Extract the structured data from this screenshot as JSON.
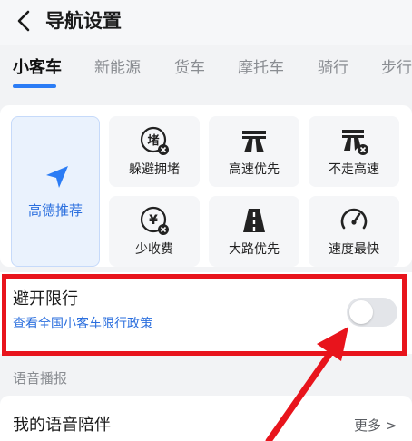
{
  "header": {
    "title": "导航设置",
    "back_icon": "chevron-left-icon"
  },
  "tabs": [
    {
      "label": "小客车",
      "active": true
    },
    {
      "label": "新能源",
      "active": false
    },
    {
      "label": "货车",
      "active": false
    },
    {
      "label": "摩托车",
      "active": false
    },
    {
      "label": "骑行",
      "active": false
    },
    {
      "label": "步行",
      "active": false
    }
  ],
  "route_options": {
    "recommended": {
      "label": "高德推荐",
      "icon": "navigation-arrow-icon"
    },
    "items": [
      {
        "label": "躲避拥堵",
        "icon": "avoid-congestion-icon"
      },
      {
        "label": "高速优先",
        "icon": "highway-icon"
      },
      {
        "label": "不走高速",
        "icon": "no-highway-icon"
      },
      {
        "label": "少收费",
        "icon": "less-toll-icon"
      },
      {
        "label": "大路优先",
        "icon": "main-road-icon"
      },
      {
        "label": "速度最快",
        "icon": "speedometer-icon"
      }
    ]
  },
  "avoid_restriction": {
    "title": "避开限行",
    "link": "查看全国小客车限行政策",
    "enabled": false
  },
  "voice_section": {
    "label": "语音播报",
    "item_title": "我的语音陪伴",
    "more": "更多 >"
  },
  "colors": {
    "accent": "#2b7cf5",
    "highlight": "#e8141c",
    "link": "#2b6fde"
  }
}
